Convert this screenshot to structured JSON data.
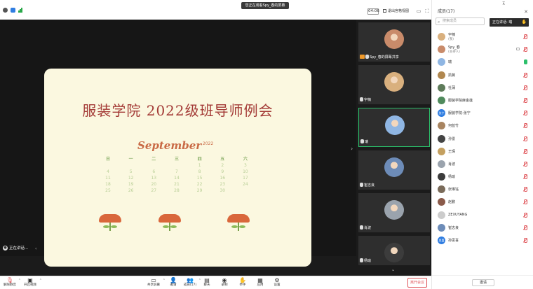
{
  "titlebar": {
    "sharing_banner": "您正在观看Spy_春的屏幕",
    "timer": "04:06",
    "gallery_label": "退出宫格视图"
  },
  "slide": {
    "title": "服装学院 2022级班导师例会",
    "month": "September",
    "month_sub": "2022",
    "calendar_rows": [
      [
        "日",
        "一",
        "二",
        "三",
        "四",
        "五",
        "六"
      ],
      [
        "",
        "",
        "",
        "",
        "1",
        "2",
        "3"
      ],
      [
        "4",
        "5",
        "6",
        "7",
        "8",
        "9",
        "10"
      ],
      [
        "11",
        "12",
        "13",
        "14",
        "15",
        "16",
        "17"
      ],
      [
        "18",
        "19",
        "20",
        "21",
        "22",
        "23",
        "24"
      ],
      [
        "25",
        "26",
        "27",
        "28",
        "29",
        "30",
        ""
      ]
    ]
  },
  "share_area": {
    "speaking_label": "正在讲话..."
  },
  "video_strip": {
    "tiles": [
      {
        "name": "Spy_春的屏幕共享",
        "active": false,
        "avatar_bg": "#c98b6a"
      },
      {
        "name": "宇楠",
        "active": false,
        "avatar_bg": "#d9b07e"
      },
      {
        "name": "瑞",
        "active": true,
        "avatar_bg": "#8fb6e3"
      },
      {
        "name": "崔志良",
        "active": false,
        "avatar_bg": "#6d8cb8"
      },
      {
        "name": "肖波",
        "active": false,
        "avatar_bg": "#9aa3ad"
      },
      {
        "name": "杨瑜",
        "active": false,
        "avatar_bg": "#3c3c3c"
      }
    ]
  },
  "panel": {
    "title": "成员(17)",
    "search_placeholder": "搜索成员",
    "speaking_now": "正在讲话: 瑞",
    "participants": [
      {
        "name": "宇楠",
        "role": "(我)",
        "avatar": "#d9b07e",
        "mic": "muted"
      },
      {
        "name": "Spy_春",
        "role": "(主持人)",
        "avatar": "#c98b6a",
        "mic": "muted",
        "cam": true
      },
      {
        "name": "瑞",
        "role": "",
        "avatar": "#8fb6e3",
        "mic": "on"
      },
      {
        "name": "凯薇",
        "role": "",
        "avatar": "#b0874f",
        "mic": "muted"
      },
      {
        "name": "杜蒲",
        "role": "",
        "avatar": "#5e7b5a",
        "mic": "muted"
      },
      {
        "name": "服装学院麻金莲",
        "role": "",
        "avatar": "#4f8a5c",
        "mic": "muted"
      },
      {
        "name": "服装学院-张宁",
        "role": "",
        "avatar": "#2f7de1",
        "mic": "muted",
        "initials": "张宁"
      },
      {
        "name": "何蓝竹",
        "role": "",
        "avatar": "#a88460",
        "mic": "muted"
      },
      {
        "name": "孙雷",
        "role": "",
        "avatar": "#444444",
        "mic": "muted"
      },
      {
        "name": "王琛",
        "role": "",
        "avatar": "#c4a060",
        "mic": "muted"
      },
      {
        "name": "肖波",
        "role": "",
        "avatar": "#9aa3ad",
        "mic": "muted"
      },
      {
        "name": "杨瑜",
        "role": "",
        "avatar": "#3c3c3c",
        "mic": "muted"
      },
      {
        "name": "张琳钰",
        "role": "",
        "avatar": "#7a6b5a",
        "mic": "muted"
      },
      {
        "name": "赵鹏",
        "role": "",
        "avatar": "#8a5a4a",
        "mic": "muted"
      },
      {
        "name": "ZEXUYANG",
        "role": "",
        "avatar": "#cccccc",
        "mic": "muted"
      },
      {
        "name": "崔志良",
        "role": "",
        "avatar": "#6d8cb8",
        "mic": "muted"
      },
      {
        "name": "孙思喜",
        "role": "",
        "avatar": "#2f7de1",
        "mic": "muted",
        "initials": "思喜"
      }
    ],
    "invite_label": "邀请"
  },
  "toolbar": {
    "unmute": "解除静音",
    "video": "开启视频",
    "share": "共享屏幕",
    "invite": "邀请",
    "members": "成员(17)",
    "chat": "聊天",
    "record": "录制",
    "react": "举手",
    "apps": "应用",
    "settings": "设置",
    "end": "离开会议"
  }
}
